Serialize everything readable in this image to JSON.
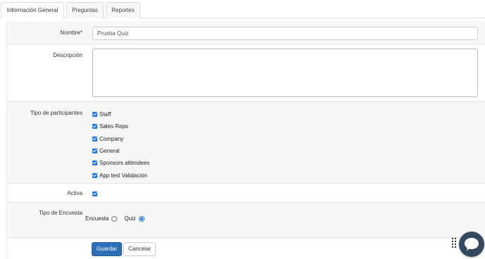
{
  "tabs": [
    {
      "label": "Información General",
      "active": true
    },
    {
      "label": "Preguntas",
      "active": false
    },
    {
      "label": "Reportes",
      "active": false
    }
  ],
  "form": {
    "nombre_label": "Nombre*",
    "nombre_value": "Prueba Quiz",
    "descripcion_label": "Descripción",
    "descripcion_value": "",
    "tipo_participantes_label": "Tipo de participantes",
    "participantes": [
      {
        "label": "Staff",
        "checked": true
      },
      {
        "label": "Sales Reps",
        "checked": true
      },
      {
        "label": "Company",
        "checked": true
      },
      {
        "label": "General",
        "checked": true
      },
      {
        "label": "Sponsors attendees",
        "checked": true
      },
      {
        "label": "App test Validación",
        "checked": true
      }
    ],
    "activa_label": "Activa",
    "activa_checked": true,
    "tipo_encuesta_label": "Tipo de Encuesta",
    "encuesta_options": [
      {
        "label": "Encuesta",
        "selected": false
      },
      {
        "label": "Quiz",
        "selected": true
      }
    ]
  },
  "actions": {
    "save_label": "Guardar",
    "cancel_label": "Cancelar"
  },
  "colors": {
    "accent": "#1a73e8",
    "primary_button": "#2d6fb7",
    "chat_bubble": "#34495e"
  },
  "icons": {
    "chat": "chat-bubble-icon",
    "grip": "drag-grip-icon"
  }
}
